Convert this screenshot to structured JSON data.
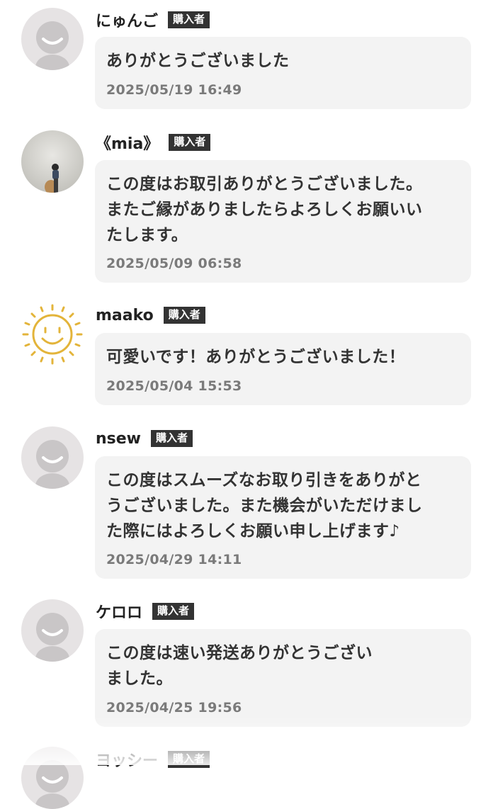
{
  "badge_label": "購入者",
  "reviews": [
    {
      "name": "にゅんご",
      "comment": "ありがとうございました",
      "date": "2025/05/19 16:49",
      "avatar": "default-person-icon"
    },
    {
      "name": "《mia》",
      "comment": "この度はお取引ありがとうございました。\nまたご縁がありましたらよろしくお願いい\nたします。",
      "date": "2025/05/09 06:58",
      "avatar": "photo"
    },
    {
      "name": "maako",
      "comment": "可愛いです！ありがとうございました！",
      "date": "2025/05/04 15:53",
      "avatar": "smiley-sun-icon"
    },
    {
      "name": "nsew",
      "comment": "この度はスムーズなお取り引きをありがと\nうございました。また機会がいただけまし\nた際にはよろしくお願い申し上げます♪",
      "date": "2025/04/29 14:11",
      "avatar": "default-person-icon"
    },
    {
      "name": "ケロロ",
      "comment": "この度は速い発送ありがとうござい\nました。",
      "date": "2025/04/25 19:56",
      "avatar": "default-person-icon"
    },
    {
      "name": "ヨッシー",
      "comment": "",
      "date": "",
      "avatar": "default-person-icon"
    }
  ],
  "colors": {
    "bubble_bg": "#f3f3f3",
    "badge_bg": "#333333",
    "date_text": "#7a7a7a",
    "avatar_bg": "#e6e3e4"
  }
}
